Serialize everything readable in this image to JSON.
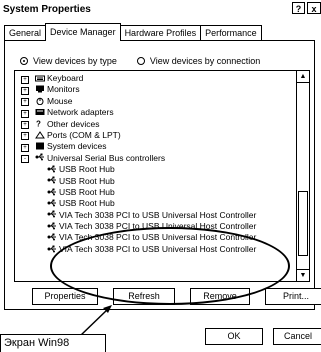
{
  "window": {
    "title": "System Properties",
    "help_btn": "?",
    "close_btn": "x"
  },
  "tabs": [
    {
      "label": "General"
    },
    {
      "label": "Device Manager"
    },
    {
      "label": "Hardware Profiles"
    },
    {
      "label": "Performance"
    }
  ],
  "view": {
    "by_type": "View devices by type",
    "by_connection": "View devices by connection"
  },
  "tree": {
    "items": [
      {
        "label": "Keyboard"
      },
      {
        "label": "Monitors"
      },
      {
        "label": "Mouse"
      },
      {
        "label": "Network adapters"
      },
      {
        "label": "Other devices"
      },
      {
        "label": "Ports (COM & LPT)"
      },
      {
        "label": "System devices"
      },
      {
        "label": "Universal Serial Bus controllers"
      },
      {
        "label": "USB Root Hub"
      },
      {
        "label": "USB Root Hub"
      },
      {
        "label": "USB Root Hub"
      },
      {
        "label": "USB Root Hub"
      },
      {
        "label": "VIA Tech 3038 PCI to USB Universal Host Controller"
      },
      {
        "label": "VIA Tech 3038 PCI to USB Universal Host Controller"
      },
      {
        "label": "VIA Tech 3038 PCI to USB Universal Host Controller"
      },
      {
        "label": "VIA Tech 3038 PCI to USB Universal Host Controller"
      }
    ]
  },
  "buttons": {
    "properties": "Properties",
    "refresh": "Refresh",
    "remove": "Remove",
    "print": "Print...",
    "ok": "OK",
    "cancel": "Cancel"
  },
  "callout": {
    "label": "Экран Win98"
  }
}
